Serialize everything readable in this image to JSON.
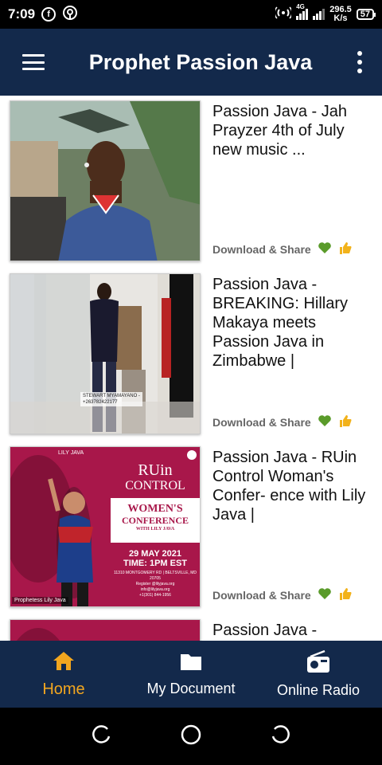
{
  "status_bar": {
    "time": "7:09",
    "network_label": "4G",
    "speed_value": "296.5",
    "speed_unit": "K/s",
    "battery": "57"
  },
  "app_bar": {
    "title": "Prophet Passion Java",
    "menu_icon": "hamburger-menu-icon",
    "overflow_icon": "more-vert-icon"
  },
  "videos": [
    {
      "title": "Passion Java - Jah Prayzer 4th of July new music ...",
      "action_label": "Download & Share",
      "thumbnail": "man-in-car-thumbnail"
    },
    {
      "title": "Passion Java - BREAKING: Hillary Makaya meets Passion Java in Zimbabwe |",
      "action_label": "Download & Share",
      "thumbnail": "man-in-hallway-thumbnail",
      "caption_line1": "STEWART MYAMAYANO -",
      "caption_line2": "+263782422177"
    },
    {
      "title": "Passion Java - RUin Control Woman's Confer- ence with Lily Java |",
      "action_label": "Download & Share",
      "thumbnail": "conference-poster-thumbnail",
      "poster_brand": "LILY JAVA",
      "poster_title1": "RUin",
      "poster_title2": "CONTROL",
      "poster_sub1": "WOMEN'S",
      "poster_sub2": "CONFERENCE",
      "poster_with": "WITH LILY JAVA",
      "poster_date": "29 MAY 2021",
      "poster_time": "TIME: 1PM EST",
      "poster_address": "11310 MONTGOMERY RD | BELTSVILLE, MD 20705",
      "poster_register": "Register @lilyjava.org",
      "poster_email": "info@lilyjava.org",
      "poster_phone": "+1(301) 844-1956",
      "poster_caption": "Prophetess Lily Java"
    },
    {
      "title": "Passion Java -",
      "thumbnail": "conference-poster-thumbnail"
    }
  ],
  "bottom_nav": [
    {
      "label": "Home",
      "icon": "home-icon"
    },
    {
      "label": "My Document",
      "icon": "folder-icon"
    },
    {
      "label": "Online Radio",
      "icon": "radio-icon"
    }
  ],
  "colors": {
    "app_bar": "#13294b",
    "active_tab": "#f2a61f",
    "heart": "#5a9b2a",
    "thumbs": "#f2b21b",
    "poster": "#a8174a"
  }
}
